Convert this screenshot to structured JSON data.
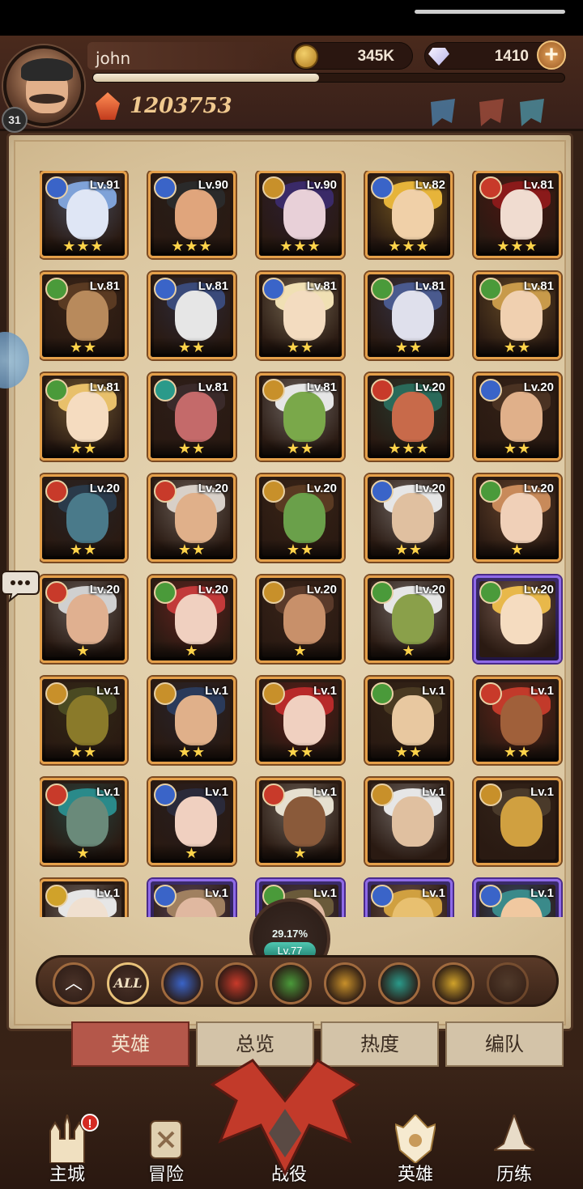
{
  "player": {
    "name": "john",
    "level": "31",
    "exp_fraction": 0.48,
    "power": "1203753"
  },
  "currencies": {
    "gold": "345K",
    "gems": "1410"
  },
  "heroes": [
    {
      "level": "Lv.91",
      "element": "blue",
      "stars": "★★★",
      "rarity": "orange",
      "palette": [
        "#dfe6f5",
        "#7fa2d8"
      ]
    },
    {
      "level": "Lv.90",
      "element": "blue",
      "stars": "★★★",
      "rarity": "orange",
      "palette": [
        "#e0a57c",
        "#2a2a2a"
      ]
    },
    {
      "level": "Lv.90",
      "element": "gold",
      "stars": "★★★",
      "rarity": "orange",
      "palette": [
        "#e8d0d8",
        "#3a2a68"
      ]
    },
    {
      "level": "Lv.82",
      "element": "blue",
      "stars": "★★★",
      "rarity": "orange",
      "palette": [
        "#f0d0a8",
        "#e6b43a"
      ]
    },
    {
      "level": "Lv.81",
      "element": "red",
      "stars": "★★★",
      "rarity": "orange",
      "palette": [
        "#f0dcd0",
        "#8a1a1a"
      ]
    },
    {
      "level": "Lv.81",
      "element": "green",
      "stars": "★★",
      "rarity": "orange",
      "palette": [
        "#b88a5c",
        "#5a3a22"
      ]
    },
    {
      "level": "Lv.81",
      "element": "blue",
      "stars": "★★",
      "rarity": "orange",
      "palette": [
        "#e6e6e6",
        "#3a4a7a"
      ]
    },
    {
      "level": "Lv.81",
      "element": "blue",
      "stars": "★★",
      "rarity": "orange",
      "palette": [
        "#f3dcc0",
        "#f0e0b4"
      ]
    },
    {
      "level": "Lv.81",
      "element": "green",
      "stars": "★★",
      "rarity": "orange",
      "palette": [
        "#dfe0ec",
        "#4a5a8e"
      ]
    },
    {
      "level": "Lv.81",
      "element": "green",
      "stars": "★★",
      "rarity": "orange",
      "palette": [
        "#f0d0b0",
        "#c89a4a"
      ]
    },
    {
      "level": "Lv.81",
      "element": "green",
      "stars": "★★",
      "rarity": "orange",
      "palette": [
        "#f5dcc0",
        "#e8c06a"
      ]
    },
    {
      "level": "Lv.81",
      "element": "teal",
      "stars": "★★",
      "rarity": "orange",
      "palette": [
        "#c46a6a",
        "#3a2a2a"
      ]
    },
    {
      "level": "Lv.81",
      "element": "gold",
      "stars": "★★",
      "rarity": "orange",
      "palette": [
        "#7aa84a",
        "#e6e6e6"
      ]
    },
    {
      "level": "Lv.20",
      "element": "red",
      "stars": "★★★",
      "rarity": "orange",
      "palette": [
        "#c86a4a",
        "#2a6a5a"
      ]
    },
    {
      "level": "Lv.20",
      "element": "blue",
      "stars": "★★",
      "rarity": "orange",
      "palette": [
        "#e0b08a",
        "#4a3222"
      ]
    },
    {
      "level": "Lv.20",
      "element": "red",
      "stars": "★★",
      "rarity": "orange",
      "palette": [
        "#4a7a8a",
        "#2a3a4a"
      ]
    },
    {
      "level": "Lv.20",
      "element": "red",
      "stars": "★★",
      "rarity": "orange",
      "palette": [
        "#e0b08a",
        "#d8d0c8"
      ]
    },
    {
      "level": "Lv.20",
      "element": "gold",
      "stars": "★★",
      "rarity": "orange",
      "palette": [
        "#6aa04a",
        "#5a3a22"
      ]
    },
    {
      "level": "Lv.20",
      "element": "blue",
      "stars": "★★",
      "rarity": "orange",
      "palette": [
        "#e0c0a0",
        "#e6e6e6"
      ]
    },
    {
      "level": "Lv.20",
      "element": "green",
      "stars": "★",
      "rarity": "orange",
      "palette": [
        "#f0d0b8",
        "#c88a5a"
      ]
    },
    {
      "level": "Lv.20",
      "element": "red",
      "stars": "★",
      "rarity": "orange",
      "palette": [
        "#e0b090",
        "#d0d0d0"
      ]
    },
    {
      "level": "Lv.20",
      "element": "green",
      "stars": "★",
      "rarity": "orange",
      "palette": [
        "#f0d0c0",
        "#c23a3a"
      ]
    },
    {
      "level": "Lv.20",
      "element": "gold",
      "stars": "★",
      "rarity": "orange",
      "palette": [
        "#c8906a",
        "#5a3a2a"
      ]
    },
    {
      "level": "Lv.20",
      "element": "green",
      "stars": "★",
      "rarity": "orange",
      "palette": [
        "#8aa04a",
        "#e6e6e6"
      ]
    },
    {
      "level": "Lv.20",
      "element": "green",
      "stars": "",
      "rarity": "purple",
      "palette": [
        "#f5dcc0",
        "#e8b84a"
      ]
    },
    {
      "level": "Lv.1",
      "element": "gold",
      "stars": "★★",
      "rarity": "orange",
      "palette": [
        "#8a7a2a",
        "#4a4a22"
      ]
    },
    {
      "level": "Lv.1",
      "element": "gold",
      "stars": "★★",
      "rarity": "orange",
      "palette": [
        "#e0b08a",
        "#2a3a5a"
      ]
    },
    {
      "level": "Lv.1",
      "element": "gold",
      "stars": "★★",
      "rarity": "orange",
      "palette": [
        "#f0d0c0",
        "#b82a2a"
      ]
    },
    {
      "level": "Lv.1",
      "element": "green",
      "stars": "★★",
      "rarity": "orange",
      "palette": [
        "#e8c8a0",
        "#4a3a22"
      ]
    },
    {
      "level": "Lv.1",
      "element": "red",
      "stars": "★★",
      "rarity": "orange",
      "palette": [
        "#a0603a",
        "#c23a2a"
      ]
    },
    {
      "level": "Lv.1",
      "element": "red",
      "stars": "★",
      "rarity": "orange",
      "palette": [
        "#6a8a7a",
        "#2a8a8a"
      ]
    },
    {
      "level": "Lv.1",
      "element": "blue",
      "stars": "★",
      "rarity": "orange",
      "palette": [
        "#f0d0c0",
        "#2a2a3a"
      ]
    },
    {
      "level": "Lv.1",
      "element": "red",
      "stars": "★",
      "rarity": "orange",
      "palette": [
        "#8a5a3a",
        "#e6e0d0"
      ]
    },
    {
      "level": "Lv.1",
      "element": "gold",
      "stars": "",
      "rarity": "orange",
      "palette": [
        "#e0c0a0",
        "#e6e6e6"
      ]
    },
    {
      "level": "Lv.1",
      "element": "gold",
      "stars": "",
      "rarity": "orange",
      "palette": [
        "#d0a040",
        "#4a3a2a"
      ]
    },
    {
      "level": "Lv.1",
      "element": "yellow",
      "stars": "",
      "rarity": "orange",
      "palette": [
        "#f0e0d0",
        "#e6e6e6"
      ]
    },
    {
      "level": "Lv.1",
      "element": "blue",
      "stars": "",
      "rarity": "purple",
      "palette": [
        "#e0b8a0",
        "#a08060"
      ]
    },
    {
      "level": "Lv.1",
      "element": "green",
      "stars": "",
      "rarity": "purple",
      "palette": [
        "#e0b8a0",
        "#6a5a3a"
      ]
    },
    {
      "level": "Lv.1",
      "element": "blue",
      "stars": "",
      "rarity": "purple",
      "palette": [
        "#e8c070",
        "#d0a040"
      ]
    },
    {
      "level": "Lv.1",
      "element": "blue",
      "stars": "",
      "rarity": "purple",
      "palette": [
        "#f0c8a0",
        "#3a8a8a"
      ]
    }
  ],
  "progress": {
    "percent": "29.17%",
    "level": "Lv.77"
  },
  "filters": [
    {
      "name": "collapse-icon",
      "label": "︿"
    },
    {
      "name": "all",
      "label": "ALL"
    },
    {
      "name": "blue-faction-icon",
      "label": ""
    },
    {
      "name": "red-faction-icon",
      "label": ""
    },
    {
      "name": "green-faction-icon",
      "label": ""
    },
    {
      "name": "gold-faction-icon",
      "label": ""
    },
    {
      "name": "teal-faction-icon",
      "label": ""
    },
    {
      "name": "yellow-faction-icon",
      "label": ""
    },
    {
      "name": "dim-faction-icon",
      "label": ""
    }
  ],
  "element_colors": {
    "blue": "#3a64c8",
    "red": "#c83a2a",
    "green": "#4a9a3a",
    "gold": "#c8902a",
    "teal": "#2a9a8a",
    "yellow": "#d0a22a",
    "dim": "#5a4a3a"
  },
  "tabs": [
    "英雄",
    "总览",
    "热度",
    "编队"
  ],
  "nav": [
    "主城",
    "冒险",
    "战役",
    "英雄",
    "历练"
  ],
  "nav_badge": "!"
}
